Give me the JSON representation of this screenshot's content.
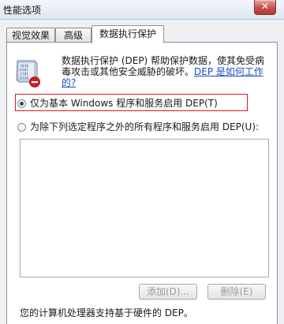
{
  "window": {
    "title": "性能选项",
    "close_glyph": "✕"
  },
  "tabs": [
    {
      "label": "视觉效果"
    },
    {
      "label": "高级"
    },
    {
      "label": "数据执行保护"
    }
  ],
  "dep": {
    "description_prefix": "数据执行保护 (DEP) 帮助保护数据，使其免受病毒攻击或其他安全威胁的破坏。",
    "link_text": "DEP 是如何工作的?",
    "option_essential": "仅为基本 Windows 程序和服务启用 DEP(T)",
    "option_all_except": "为除下列选定程序之外的所有程序和服务启用 DEP(U):",
    "selected_option": "essential",
    "add_button": "添加(D)...",
    "remove_button": "删除(E)",
    "footer": "您的计算机处理器支持基于硬件的 DEP。"
  },
  "colors": {
    "highlight_border": "#d31a24",
    "link": "#1a4fbf",
    "close_button": "#c75050"
  },
  "icons": {
    "dep_icon": "shield-with-binary-and-red-badge-icon"
  }
}
